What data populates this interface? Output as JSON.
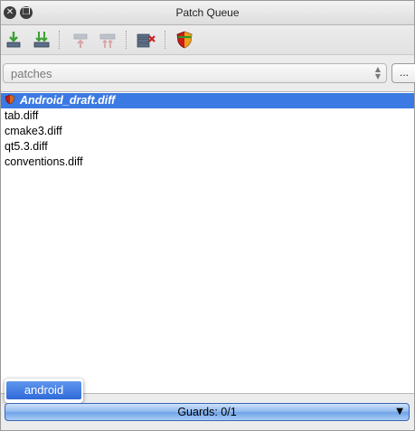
{
  "window": {
    "title": "Patch Queue",
    "close_glyph": "✕",
    "float_glyph": "❐"
  },
  "toolbar": {
    "icons": [
      {
        "name": "qpush-icon",
        "color": "#3aa033"
      },
      {
        "name": "qpush-all-icon",
        "color": "#3aa033"
      },
      {
        "name": "qpop-icon",
        "color": "#c85a5a"
      },
      {
        "name": "qpop-all-icon",
        "color": "#c85a5a"
      },
      {
        "name": "qdelete-icon",
        "color": "#cc2222"
      },
      {
        "name": "guard-shield-icon",
        "color": "#d01818"
      }
    ]
  },
  "queue_selector": {
    "value": "patches",
    "up_arrow": "▲",
    "down_arrow": "▼",
    "more_label": "..."
  },
  "patches": [
    {
      "name": "Android_draft.diff",
      "selected": true,
      "guarded": true
    },
    {
      "name": "tab.diff",
      "selected": false,
      "guarded": false
    },
    {
      "name": "cmake3.diff",
      "selected": false,
      "guarded": false
    },
    {
      "name": "qt5.3.diff",
      "selected": false,
      "guarded": false
    },
    {
      "name": "conventions.diff",
      "selected": false,
      "guarded": false
    }
  ],
  "guards_popup": {
    "items": [
      "android"
    ]
  },
  "guards_bar": {
    "label": "Guards: 0/1",
    "arrow": "▼"
  },
  "colors": {
    "selection": "#3c7ae3",
    "guard_bar": "#8db7ee"
  }
}
